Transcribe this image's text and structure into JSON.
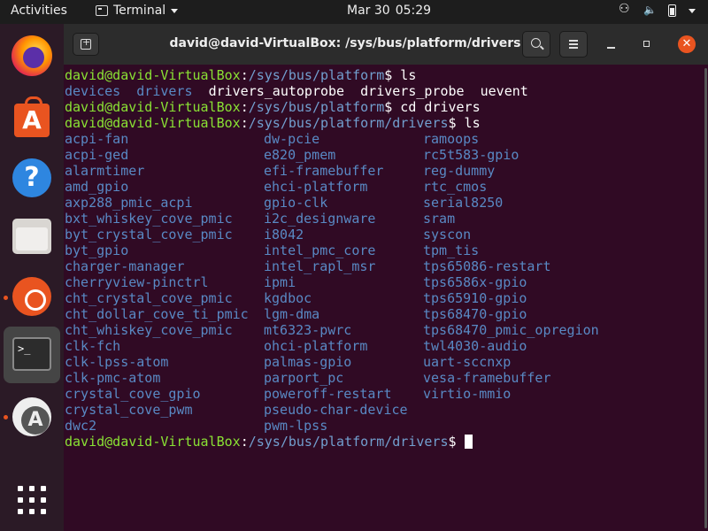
{
  "topbar": {
    "activities": "Activities",
    "app_name": "Terminal",
    "date": "Mar 30",
    "time": "05:29"
  },
  "dock": {
    "items": [
      "Firefox",
      "Ubuntu Software",
      "Help",
      "Files",
      "Ubuntu",
      "Terminal",
      "Software Updater",
      "Show Applications"
    ],
    "accent": "#e95420"
  },
  "window": {
    "title": "david@david-VirtualBox: /sys/bus/platform/drivers"
  },
  "terminal": {
    "prompt_user": "david@david-VirtualBox",
    "lines": [
      {
        "path": "/sys/bus/platform",
        "cmd": " ls"
      },
      {
        "path": "/sys/bus/platform",
        "cmd": " cd drivers"
      },
      {
        "path": "/sys/bus/platform/drivers",
        "cmd": " ls"
      },
      {
        "path": "/sys/bus/platform/drivers",
        "cmd": " "
      }
    ],
    "platform_ls": {
      "dirs": [
        "devices",
        "drivers"
      ],
      "files": [
        "drivers_autoprobe",
        "drivers_probe",
        "uevent"
      ]
    },
    "drivers_col1": [
      "acpi-fan",
      "acpi-ged",
      "alarmtimer",
      "amd_gpio",
      "axp288_pmic_acpi",
      "bxt_whiskey_cove_pmic",
      "byt_crystal_cove_pmic",
      "byt_gpio",
      "charger-manager",
      "cherryview-pinctrl",
      "cht_crystal_cove_pmic",
      "cht_dollar_cove_ti_pmic",
      "cht_whiskey_cove_pmic",
      "clk-fch",
      "clk-lpss-atom",
      "clk-pmc-atom",
      "crystal_cove_gpio",
      "crystal_cove_pwm",
      "dwc2"
    ],
    "drivers_col2": [
      "dw-pcie",
      "e820_pmem",
      "efi-framebuffer",
      "ehci-platform",
      "gpio-clk",
      "i2c_designware",
      "i8042",
      "intel_pmc_core",
      "intel_rapl_msr",
      "ipmi",
      "kgdboc",
      "lgm-dma",
      "mt6323-pwrc",
      "ohci-platform",
      "palmas-gpio",
      "parport_pc",
      "poweroff-restart",
      "pseudo-char-device",
      "pwm-lpss"
    ],
    "drivers_col3": [
      "ramoops",
      "rc5t583-gpio",
      "reg-dummy",
      "rtc_cmos",
      "serial8250",
      "sram",
      "syscon",
      "tpm_tis",
      "tps65086-restart",
      "tps6586x-gpio",
      "tps65910-gpio",
      "tps68470-gpio",
      "tps68470_pmic_opregion",
      "twl4030-audio",
      "uart-sccnxp",
      "vesa-framebuffer",
      "virtio-mmio"
    ]
  }
}
